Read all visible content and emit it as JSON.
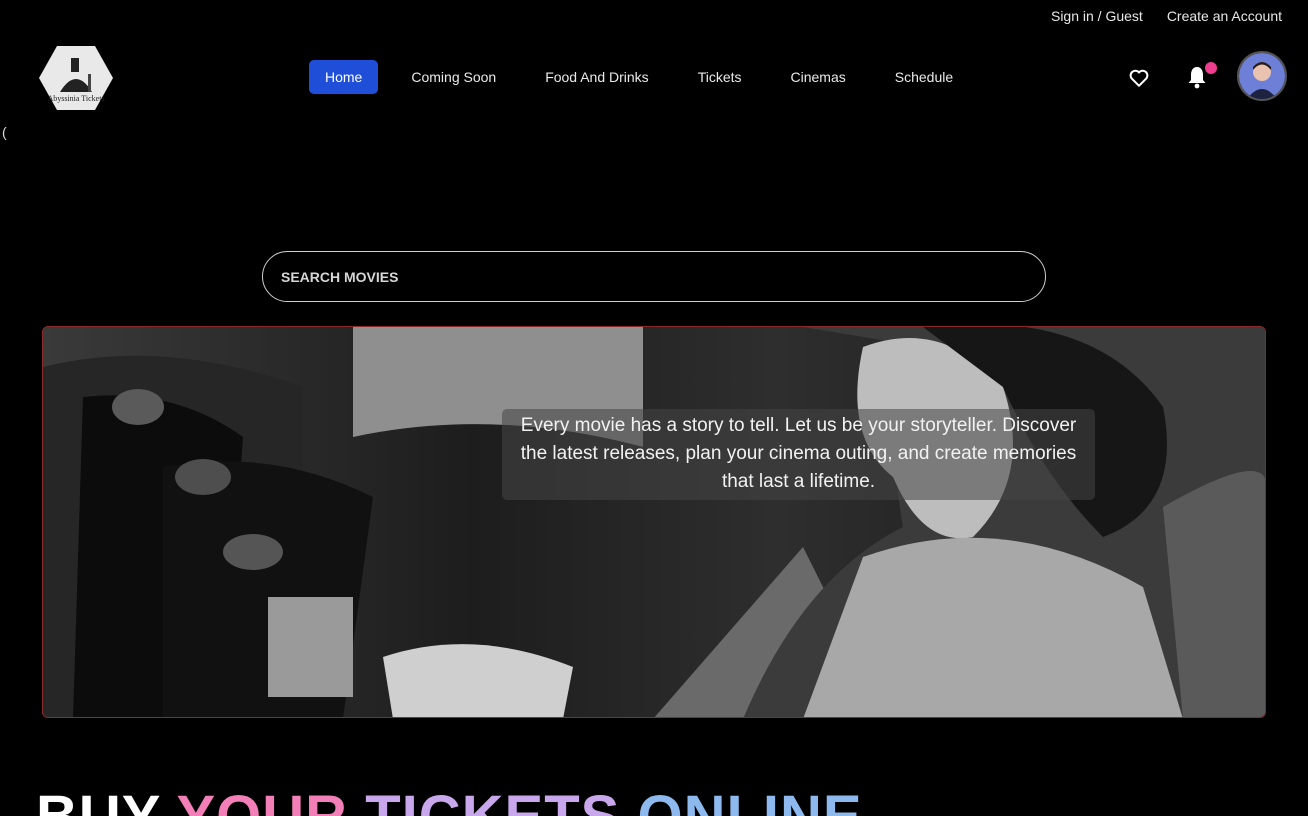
{
  "top_links": {
    "signin": "Sign in / Guest",
    "create_account": "Create an Account"
  },
  "logo": {
    "text": "Abyssinia Tickets",
    "icon": "cinema-logo-icon"
  },
  "stray_char": "(",
  "nav": {
    "items": [
      {
        "label": "Home",
        "active": true
      },
      {
        "label": "Coming Soon",
        "active": false
      },
      {
        "label": "Food And Drinks",
        "active": false
      },
      {
        "label": "Tickets",
        "active": false
      },
      {
        "label": "Cinemas",
        "active": false
      },
      {
        "label": "Schedule",
        "active": false
      }
    ]
  },
  "icons": {
    "favorite": "heart-icon",
    "notifications": "bell-icon",
    "profile": "avatar"
  },
  "search": {
    "placeholder": "SEARCH MOVIES"
  },
  "hero": {
    "caption": "Every movie has a story to tell. Let us be your storyteller. Discover the latest releases, plan your cinema outing, and create memories that last a lifetime."
  },
  "headline": {
    "w1": "BUY",
    "w2": "YOUR",
    "w3": "TICKETS",
    "w4": "ONLINE"
  },
  "colors": {
    "accent": "#1f4fd9",
    "notification_dot": "#ee3d8f",
    "hero_border": "#8a2a2a",
    "your": "#f27fb7",
    "tickets": "#c9a7ec",
    "online": "#8db9ee"
  }
}
